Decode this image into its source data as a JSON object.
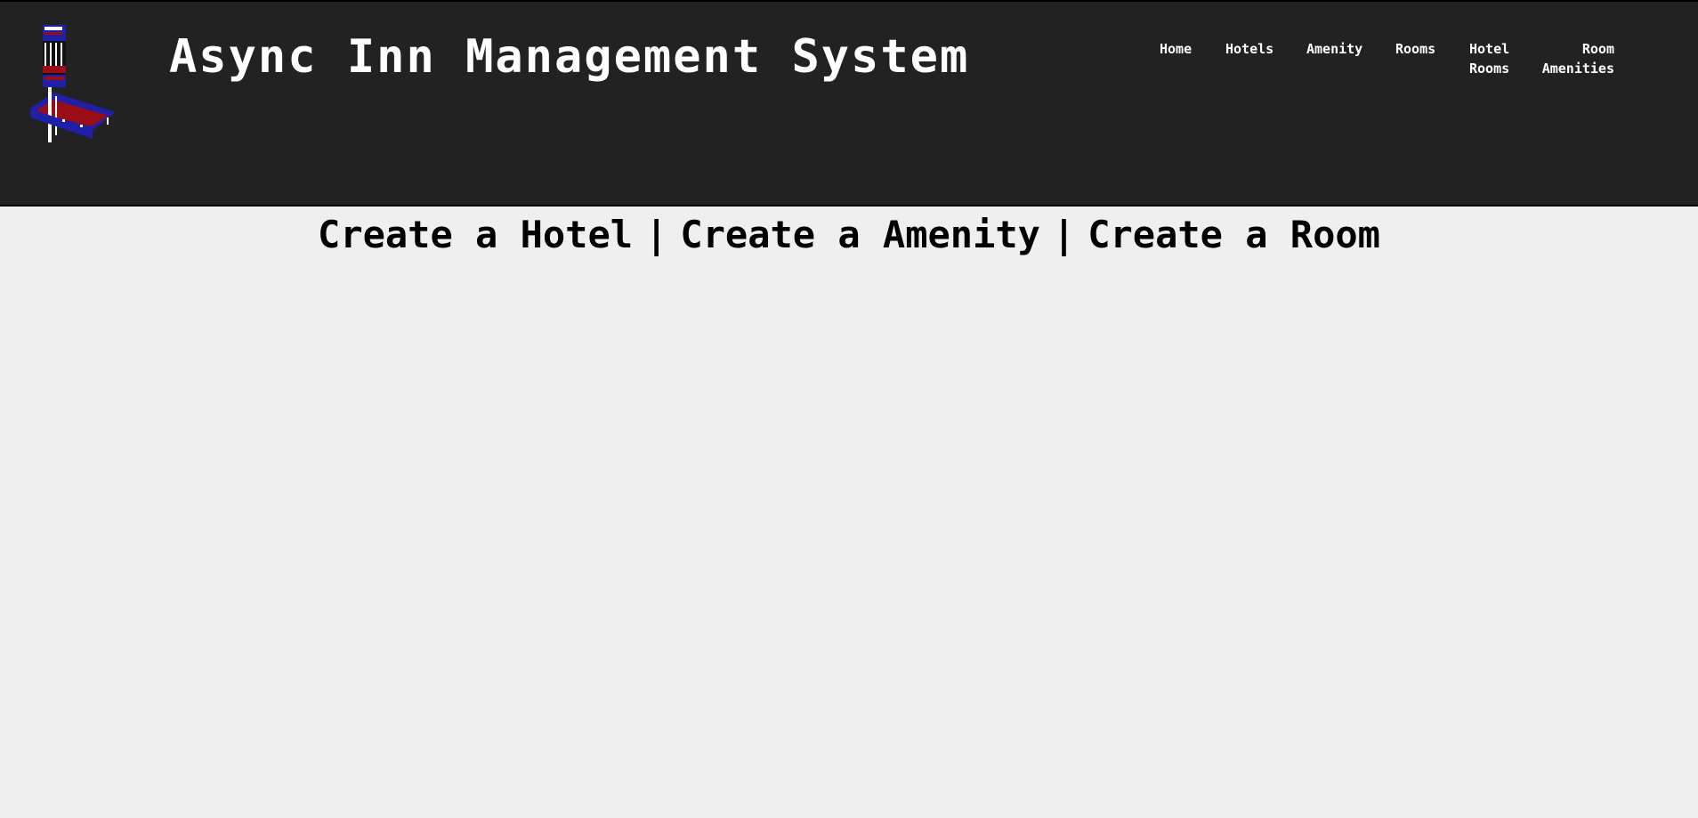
{
  "header": {
    "title": "Async Inn Management System",
    "logo_icon": "hotel-building-logo-icon",
    "background": "#222222",
    "text_color": "#ffffff"
  },
  "nav": {
    "home": "Home",
    "hotels": "Hotels",
    "amenity": "Amenity",
    "rooms": "Rooms",
    "hotel_rooms_line1": "Hotel",
    "hotel_rooms_line2": "Rooms",
    "room_amenities_line1": "Room",
    "room_amenities_line2": "Amenities"
  },
  "actions": {
    "create_hotel": "Create a Hotel",
    "create_amenity": "Create a Amenity",
    "create_room": "Create a Room",
    "separator": "|"
  },
  "colors": {
    "page_background": "#efefef",
    "logo_red": "#9b0d14",
    "logo_blue": "#1f1fa8"
  }
}
